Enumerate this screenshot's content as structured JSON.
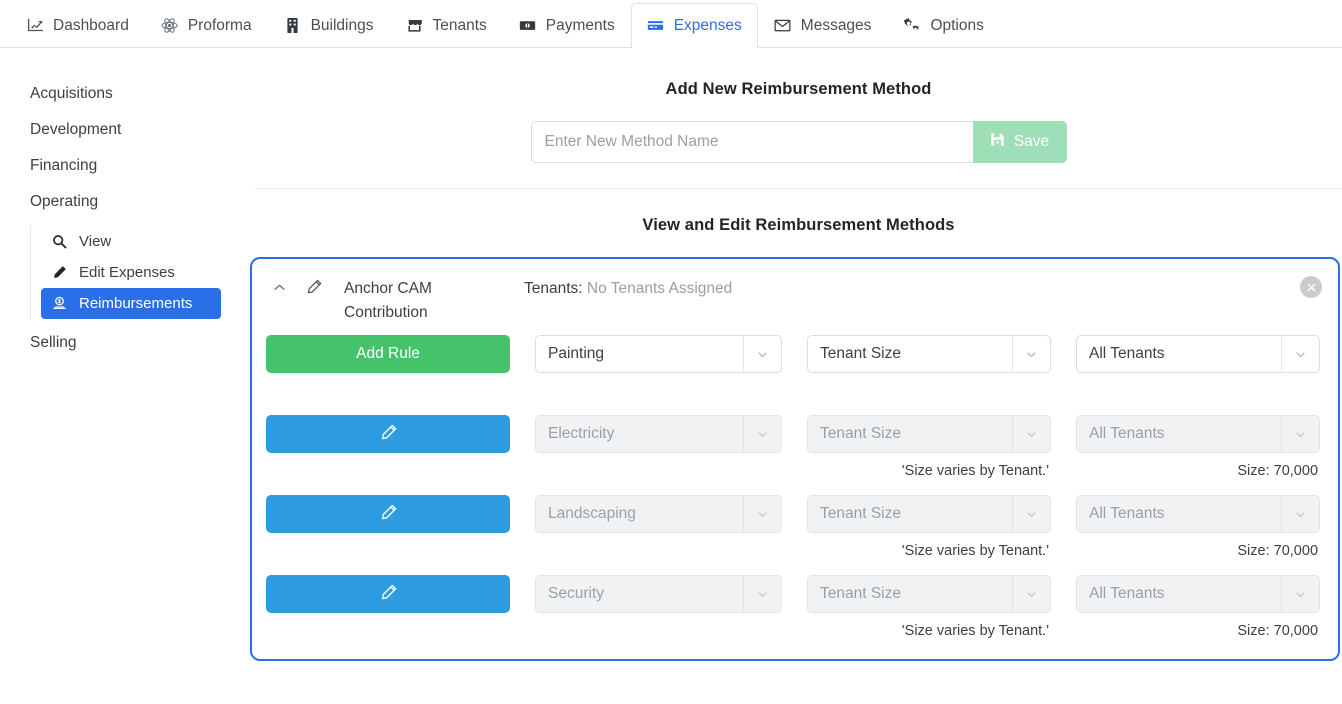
{
  "topnav": {
    "tabs": [
      {
        "label": "Dashboard",
        "icon": "chart-line-icon",
        "active": false
      },
      {
        "label": "Proforma",
        "icon": "atom-icon",
        "active": false
      },
      {
        "label": "Buildings",
        "icon": "building-icon",
        "active": false
      },
      {
        "label": "Tenants",
        "icon": "store-icon",
        "active": false
      },
      {
        "label": "Payments",
        "icon": "money-bill-icon",
        "active": false
      },
      {
        "label": "Expenses",
        "icon": "credit-card-icon",
        "active": true
      },
      {
        "label": "Messages",
        "icon": "envelope-icon",
        "active": false
      },
      {
        "label": "Options",
        "icon": "cogs-icon",
        "active": false
      }
    ]
  },
  "sidebar": {
    "items": [
      {
        "label": "Acquisitions"
      },
      {
        "label": "Development"
      },
      {
        "label": "Financing"
      },
      {
        "label": "Operating"
      },
      {
        "label": "Selling"
      }
    ],
    "sub_items": [
      {
        "label": "View",
        "icon": "search-icon",
        "active": false
      },
      {
        "label": "Edit Expenses",
        "icon": "pencil-icon",
        "active": false
      },
      {
        "label": "Reimbursements",
        "icon": "money-hand-icon",
        "active": true
      }
    ]
  },
  "add_method": {
    "title": "Add New Reimbursement Method",
    "placeholder": "Enter New Method Name",
    "value": "",
    "save_label": "Save",
    "save_icon": "floppy-save-icon"
  },
  "view_edit": {
    "title": "View and Edit Reimbursement Methods"
  },
  "card": {
    "collapse_icon": "chevron-up-icon",
    "edit_icon": "pencil-icon",
    "method_name": "Anchor CAM Contribution",
    "tenants_label": "Tenants:",
    "tenants_value": "No Tenants Assigned",
    "close_icon": "close-circle-icon",
    "rules": [
      {
        "action_label": "Add Rule",
        "action_type": "add",
        "action_icon": "",
        "expense": "Painting",
        "basis": "Tenant Size",
        "tenant_scope": "All Tenants",
        "disabled": false,
        "basis_note": "",
        "size_note": ""
      },
      {
        "action_label": "",
        "action_type": "edit",
        "action_icon": "pencil-icon",
        "expense": "Electricity",
        "basis": "Tenant Size",
        "tenant_scope": "All Tenants",
        "disabled": true,
        "basis_note": "'Size varies by Tenant.'",
        "size_note": "Size: 70,000"
      },
      {
        "action_label": "",
        "action_type": "edit",
        "action_icon": "pencil-icon",
        "expense": "Landscaping",
        "basis": "Tenant Size",
        "tenant_scope": "All Tenants",
        "disabled": true,
        "basis_note": "'Size varies by Tenant.'",
        "size_note": "Size: 70,000"
      },
      {
        "action_label": "",
        "action_type": "edit",
        "action_icon": "pencil-icon",
        "expense": "Security",
        "basis": "Tenant Size",
        "tenant_scope": "All Tenants",
        "disabled": true,
        "basis_note": "'Size varies by Tenant.'",
        "size_note": "Size: 70,000"
      }
    ]
  },
  "colors": {
    "accent_blue": "#2b6fe8",
    "edit_blue": "#2e9ce0",
    "add_green": "#45c36a",
    "save_green": "#9fdfb8",
    "muted_text": "#9aa0a6"
  }
}
